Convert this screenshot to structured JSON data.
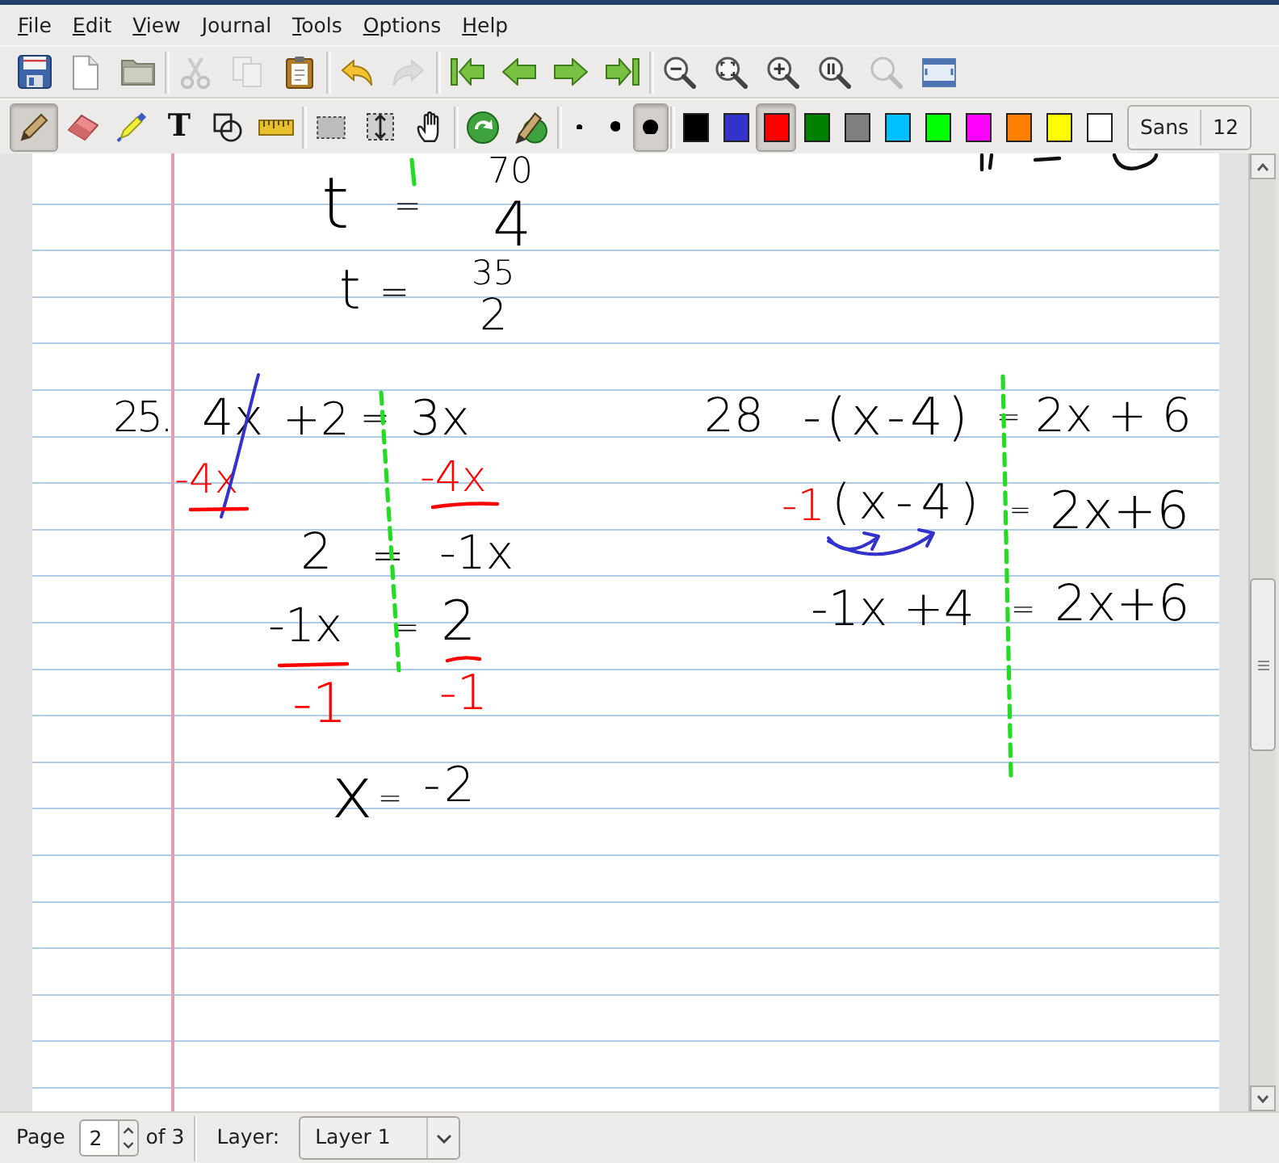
{
  "menu": [
    "File",
    "Edit",
    "View",
    "Journal",
    "Tools",
    "Options",
    "Help"
  ],
  "main_toolbar": [
    [
      {
        "disabled": false
      },
      {
        "disabled": false
      },
      {
        "disabled": false
      }
    ],
    [
      {
        "disabled": true
      },
      {
        "disabled": true
      },
      {
        "disabled": false
      }
    ],
    [
      {
        "disabled": false
      },
      {
        "disabled": true
      }
    ],
    [
      {
        "disabled": false
      },
      {
        "disabled": false
      },
      {
        "disabled": false
      },
      {
        "disabled": false
      }
    ],
    [
      {
        "disabled": false
      },
      {
        "disabled": false
      },
      {
        "disabled": false
      },
      {
        "disabled": false
      },
      {
        "disabled": true
      },
      {
        "disabled": false
      }
    ]
  ],
  "pen_toolbar": {
    "tools": [
      {
        "selected": true
      },
      {
        "selected": false
      },
      {
        "selected": false
      },
      {
        "selected": false,
        "label": "T"
      },
      {
        "selected": false
      },
      {
        "selected": false
      },
      {
        "selected": false
      },
      {
        "selected": false
      },
      {
        "selected": false
      }
    ],
    "thickness": [
      {
        "selected": false
      },
      {
        "selected": false
      },
      {
        "selected": true
      }
    ],
    "colors": [
      {
        "color": "#000000",
        "selected": false
      },
      {
        "color": "#3333cc",
        "selected": false
      },
      {
        "color": "#ff0000",
        "selected": true
      },
      {
        "color": "#008000",
        "selected": false
      },
      {
        "color": "#808080",
        "selected": false
      },
      {
        "color": "#00c0ff",
        "selected": false
      },
      {
        "color": "#00ff00",
        "selected": false
      },
      {
        "color": "#ff00ff",
        "selected": false
      },
      {
        "color": "#ff8000",
        "selected": false
      },
      {
        "color": "#ffff00",
        "selected": false
      },
      {
        "color": "#ffffff",
        "selected": false
      }
    ],
    "font": {
      "name": "Sans",
      "size": "12"
    }
  },
  "page": {
    "carryover": [
      {
        "tokens": [
          {
            "text": "t",
            "color": "#000000"
          },
          {
            "text": "=",
            "color": "#000000"
          },
          {
            "text": "70",
            "color": "#000000"
          },
          {
            "text": "4",
            "color": "#000000"
          }
        ]
      },
      {
        "tokens": [
          {
            "text": "t",
            "color": "#000000"
          },
          {
            "text": "=",
            "color": "#000000"
          },
          {
            "text": "35",
            "color": "#000000"
          },
          {
            "text": "2",
            "color": "#000000"
          }
        ]
      }
    ],
    "problems": [
      {
        "number": "25.",
        "steps": [
          {
            "tokens": [
              {
                "text": "4x",
                "color": "#000000"
              },
              {
                "text": "+2",
                "color": "#000000"
              },
              {
                "text": "=",
                "color": "#000000"
              },
              {
                "text": "3x",
                "color": "#000000"
              }
            ]
          },
          {
            "tokens": [
              {
                "text": "-4x",
                "color": "#ff0000"
              },
              {
                "text": "-4x",
                "color": "#ff0000"
              }
            ]
          },
          {
            "tokens": [
              {
                "text": "2",
                "color": "#000000"
              },
              {
                "text": "=",
                "color": "#000000"
              },
              {
                "text": "-1x",
                "color": "#000000"
              }
            ]
          },
          {
            "tokens": [
              {
                "text": "-1x",
                "color": "#000000"
              },
              {
                "text": "=",
                "color": "#000000"
              },
              {
                "text": "2",
                "color": "#000000"
              }
            ]
          },
          {
            "tokens": [
              {
                "text": "-1",
                "color": "#ff0000"
              },
              {
                "text": "-1",
                "color": "#ff0000"
              }
            ]
          },
          {
            "tokens": [
              {
                "text": "x",
                "color": "#000000"
              },
              {
                "text": "=",
                "color": "#000000"
              },
              {
                "text": "-2",
                "color": "#000000"
              }
            ]
          }
        ]
      },
      {
        "number": "28",
        "steps": [
          {
            "tokens": [
              {
                "text": "-(x-4)",
                "color": "#000000"
              },
              {
                "text": "=",
                "color": "#000000"
              },
              {
                "text": "2x + 6",
                "color": "#000000"
              }
            ]
          },
          {
            "tokens": [
              {
                "text": "-1",
                "color": "#ff0000"
              },
              {
                "text": "(x-4)",
                "color": "#000000"
              },
              {
                "text": "=",
                "color": "#000000"
              },
              {
                "text": "2x+6",
                "color": "#000000"
              }
            ]
          },
          {
            "tokens": [
              {
                "text": "-1x +4",
                "color": "#000000"
              },
              {
                "text": "=",
                "color": "#000000"
              },
              {
                "text": "2x+6",
                "color": "#000000"
              }
            ]
          }
        ]
      }
    ]
  },
  "status_bar": {
    "page_label": "Page",
    "page_number": "2",
    "page_count": "of 3",
    "layer_label": "Layer:",
    "layer": "Layer 1"
  }
}
